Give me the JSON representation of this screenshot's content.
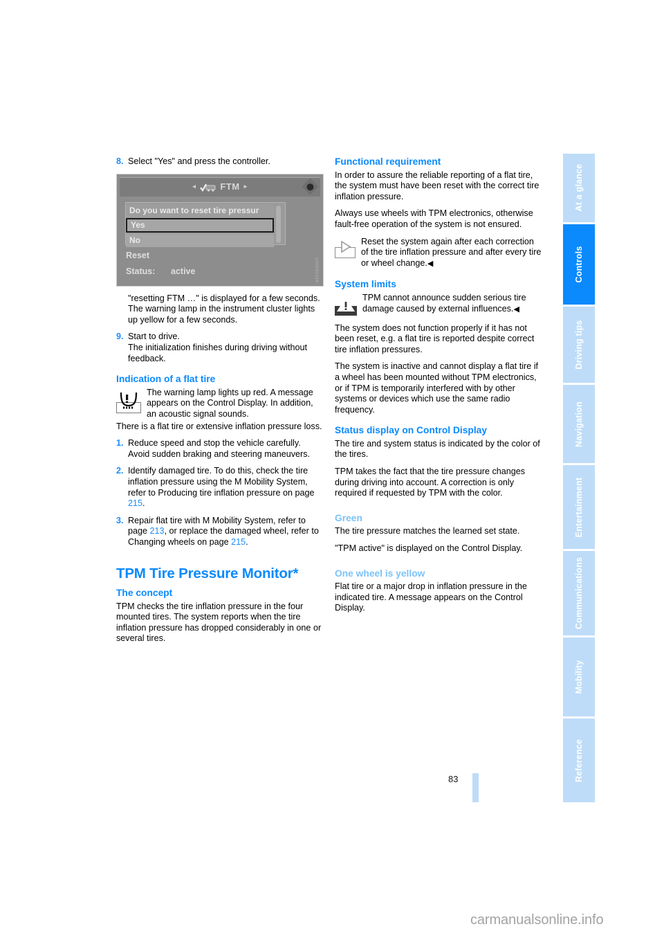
{
  "page": {
    "number": "83",
    "footer_watermark": "carmanualsonline.info"
  },
  "sidebar": {
    "items": [
      {
        "label": "At a glance",
        "active": false
      },
      {
        "label": "Controls",
        "active": true
      },
      {
        "label": "Driving tips",
        "active": false
      },
      {
        "label": "Navigation",
        "active": false
      },
      {
        "label": "Entertainment",
        "active": false
      },
      {
        "label": "Communications",
        "active": false
      },
      {
        "label": "Mobility",
        "active": false
      },
      {
        "label": "Reference",
        "active": false
      }
    ],
    "active_color": "#0a8afc",
    "inactive_color": "#bedcf8"
  },
  "left_column": {
    "step8": {
      "num": "8.",
      "text": "Select \"Yes\" and press the controller."
    },
    "figure": {
      "title": "FTM",
      "arrow_left": "◂",
      "arrow_right": "▸",
      "prompt": "Do you want to reset tire pressur",
      "option_yes": "Yes",
      "option_no": "No",
      "reset_label": "Reset",
      "status_label": "Status:",
      "status_value": "active",
      "watermark": "US0051024"
    },
    "after_figure": "\"resetting FTM …\" is displayed for a few seconds. The warning lamp in the instrument cluster lights up yellow for a few seconds.",
    "step9": {
      "num": "9.",
      "text": "Start to drive.",
      "text2": "The initialization finishes during driving without feedback."
    },
    "flat_tire_heading": "Indication of a flat tire",
    "flat_tire_icon_text": "The warning lamp lights up red. A message appears on the Control Display. In addition, an acoustic signal sounds.",
    "flat_tire_para": "There is a flat tire or extensive inflation pressure loss.",
    "steps": [
      {
        "num": "1.",
        "text": "Reduce speed and stop the vehicle carefully. Avoid sudden braking and steering maneuvers."
      },
      {
        "num": "2.",
        "text_a": "Identify damaged tire. To do this, check the tire inflation pressure using the M Mobility System, refer to Producing tire inflation pressure on page ",
        "ref": "215",
        "text_b": "."
      },
      {
        "num": "3.",
        "text_a": "Repair flat tire with M Mobility System, refer to page ",
        "ref1": "213",
        "text_b": ", or replace the damaged wheel, refer to Changing wheels on page ",
        "ref2": "215",
        "text_c": "."
      }
    ],
    "tpm_heading": "TPM Tire Pressure Monitor*",
    "concept_heading": "The concept",
    "concept_text": "TPM checks the tire inflation pressure in the four mounted tires. The system reports when the tire inflation pressure has dropped considerably in one or several tires."
  },
  "right_column": {
    "functional_heading": "Functional requirement",
    "functional_p1": "In order to assure the reliable reporting of a flat tire, the system must have been reset with the correct tire inflation pressure.",
    "functional_p2": "Always use wheels with TPM electronics, otherwise fault-free operation of the system is not ensured.",
    "note_text": "Reset the system again after each correction of the tire inflation pressure and after every tire or wheel change.",
    "end_mark": "◀",
    "limits_heading": "System limits",
    "limits_warn_text": "TPM cannot announce sudden serious tire damage caused by external influences.",
    "limits_p1": "The system does not function properly if it has not been reset, e.g. a flat tire is reported despite correct tire inflation pressures.",
    "limits_p2": "The system is inactive and cannot display a flat tire if a wheel has been mounted without TPM electronics, or if TPM is temporarily interfered with by other systems or devices which use the same radio frequency.",
    "status_heading": "Status display on Control Display",
    "status_p1": "The tire and system status is indicated by the color of the tires.",
    "status_p2": "TPM takes the fact that the tire pressure changes during driving into account. A correction is only required if requested by TPM with the color.",
    "green_heading": "Green",
    "green_p1": "The tire pressure matches the learned set state.",
    "green_p2": "\"TPM active\" is displayed on the Control Display.",
    "yellow_heading": "One wheel is yellow",
    "yellow_p1": "Flat tire or a major drop in inflation pressure in the indicated tire. A message appears on the Control Display."
  }
}
